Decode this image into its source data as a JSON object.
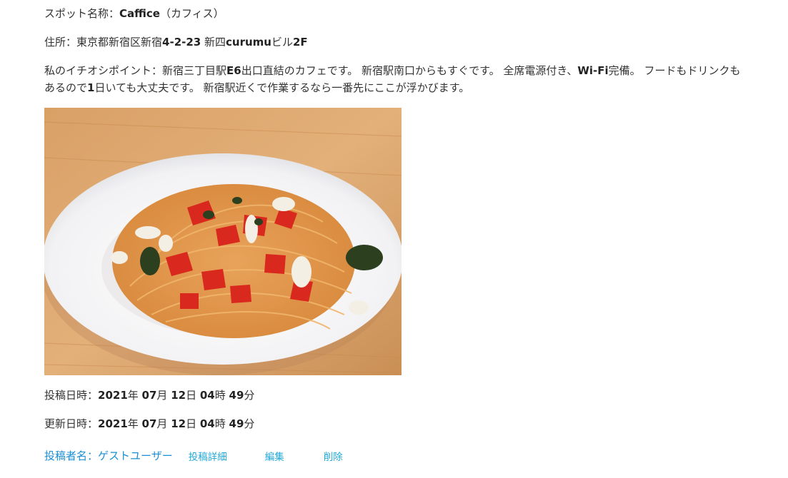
{
  "spot": {
    "label": "スポット名称：",
    "name_bold": "Caffice",
    "name_rest": "（カフィス）"
  },
  "address": {
    "label": "住所：",
    "parts": [
      {
        "text": "東京都新宿区新宿",
        "bold": false
      },
      {
        "text": "4-2-23",
        "bold": true
      },
      {
        "text": " 新四",
        "bold": false
      },
      {
        "text": "curumu",
        "bold": true
      },
      {
        "text": "ビル",
        "bold": false
      },
      {
        "text": "2F",
        "bold": true
      }
    ]
  },
  "recommend": {
    "label": "私のイチオシポイント：",
    "parts": [
      {
        "text": "新宿三丁目駅",
        "bold": false
      },
      {
        "text": "E6",
        "bold": true
      },
      {
        "text": "出口直結のカフェです。 新宿駅南口からもすぐです。 全席電源付き、",
        "bold": false
      },
      {
        "text": "Wi-Fi",
        "bold": true
      },
      {
        "text": "完備。 フードもドリンクもあるので",
        "bold": false
      },
      {
        "text": "1",
        "bold": true
      },
      {
        "text": "日いても大丈夫です。 新宿駅近くで作業するなら一番先にここが浮かびます。",
        "bold": false
      }
    ]
  },
  "photo": {
    "alt": "pasta-photo"
  },
  "posted": {
    "label": "投稿日時：",
    "parts": [
      {
        "text": "2021",
        "bold": true
      },
      {
        "text": "年 ",
        "bold": false
      },
      {
        "text": "07",
        "bold": true
      },
      {
        "text": "月 ",
        "bold": false
      },
      {
        "text": "12",
        "bold": true
      },
      {
        "text": "日 ",
        "bold": false
      },
      {
        "text": "04",
        "bold": true
      },
      {
        "text": "時 ",
        "bold": false
      },
      {
        "text": "49",
        "bold": true
      },
      {
        "text": "分",
        "bold": false
      }
    ]
  },
  "updated": {
    "label": "更新日時：",
    "parts": [
      {
        "text": "2021",
        "bold": true
      },
      {
        "text": "年 ",
        "bold": false
      },
      {
        "text": "07",
        "bold": true
      },
      {
        "text": "月 ",
        "bold": false
      },
      {
        "text": "12",
        "bold": true
      },
      {
        "text": "日 ",
        "bold": false
      },
      {
        "text": "04",
        "bold": true
      },
      {
        "text": "時 ",
        "bold": false
      },
      {
        "text": "49",
        "bold": true
      },
      {
        "text": "分",
        "bold": false
      }
    ]
  },
  "actions": {
    "author": "投稿者名：ゲストユーザー",
    "detail": "投稿詳細",
    "edit": "編集",
    "delete": "削除"
  },
  "colors": {
    "author": "#1a8fd6",
    "link": "#20a8d8",
    "text": "#333333"
  }
}
